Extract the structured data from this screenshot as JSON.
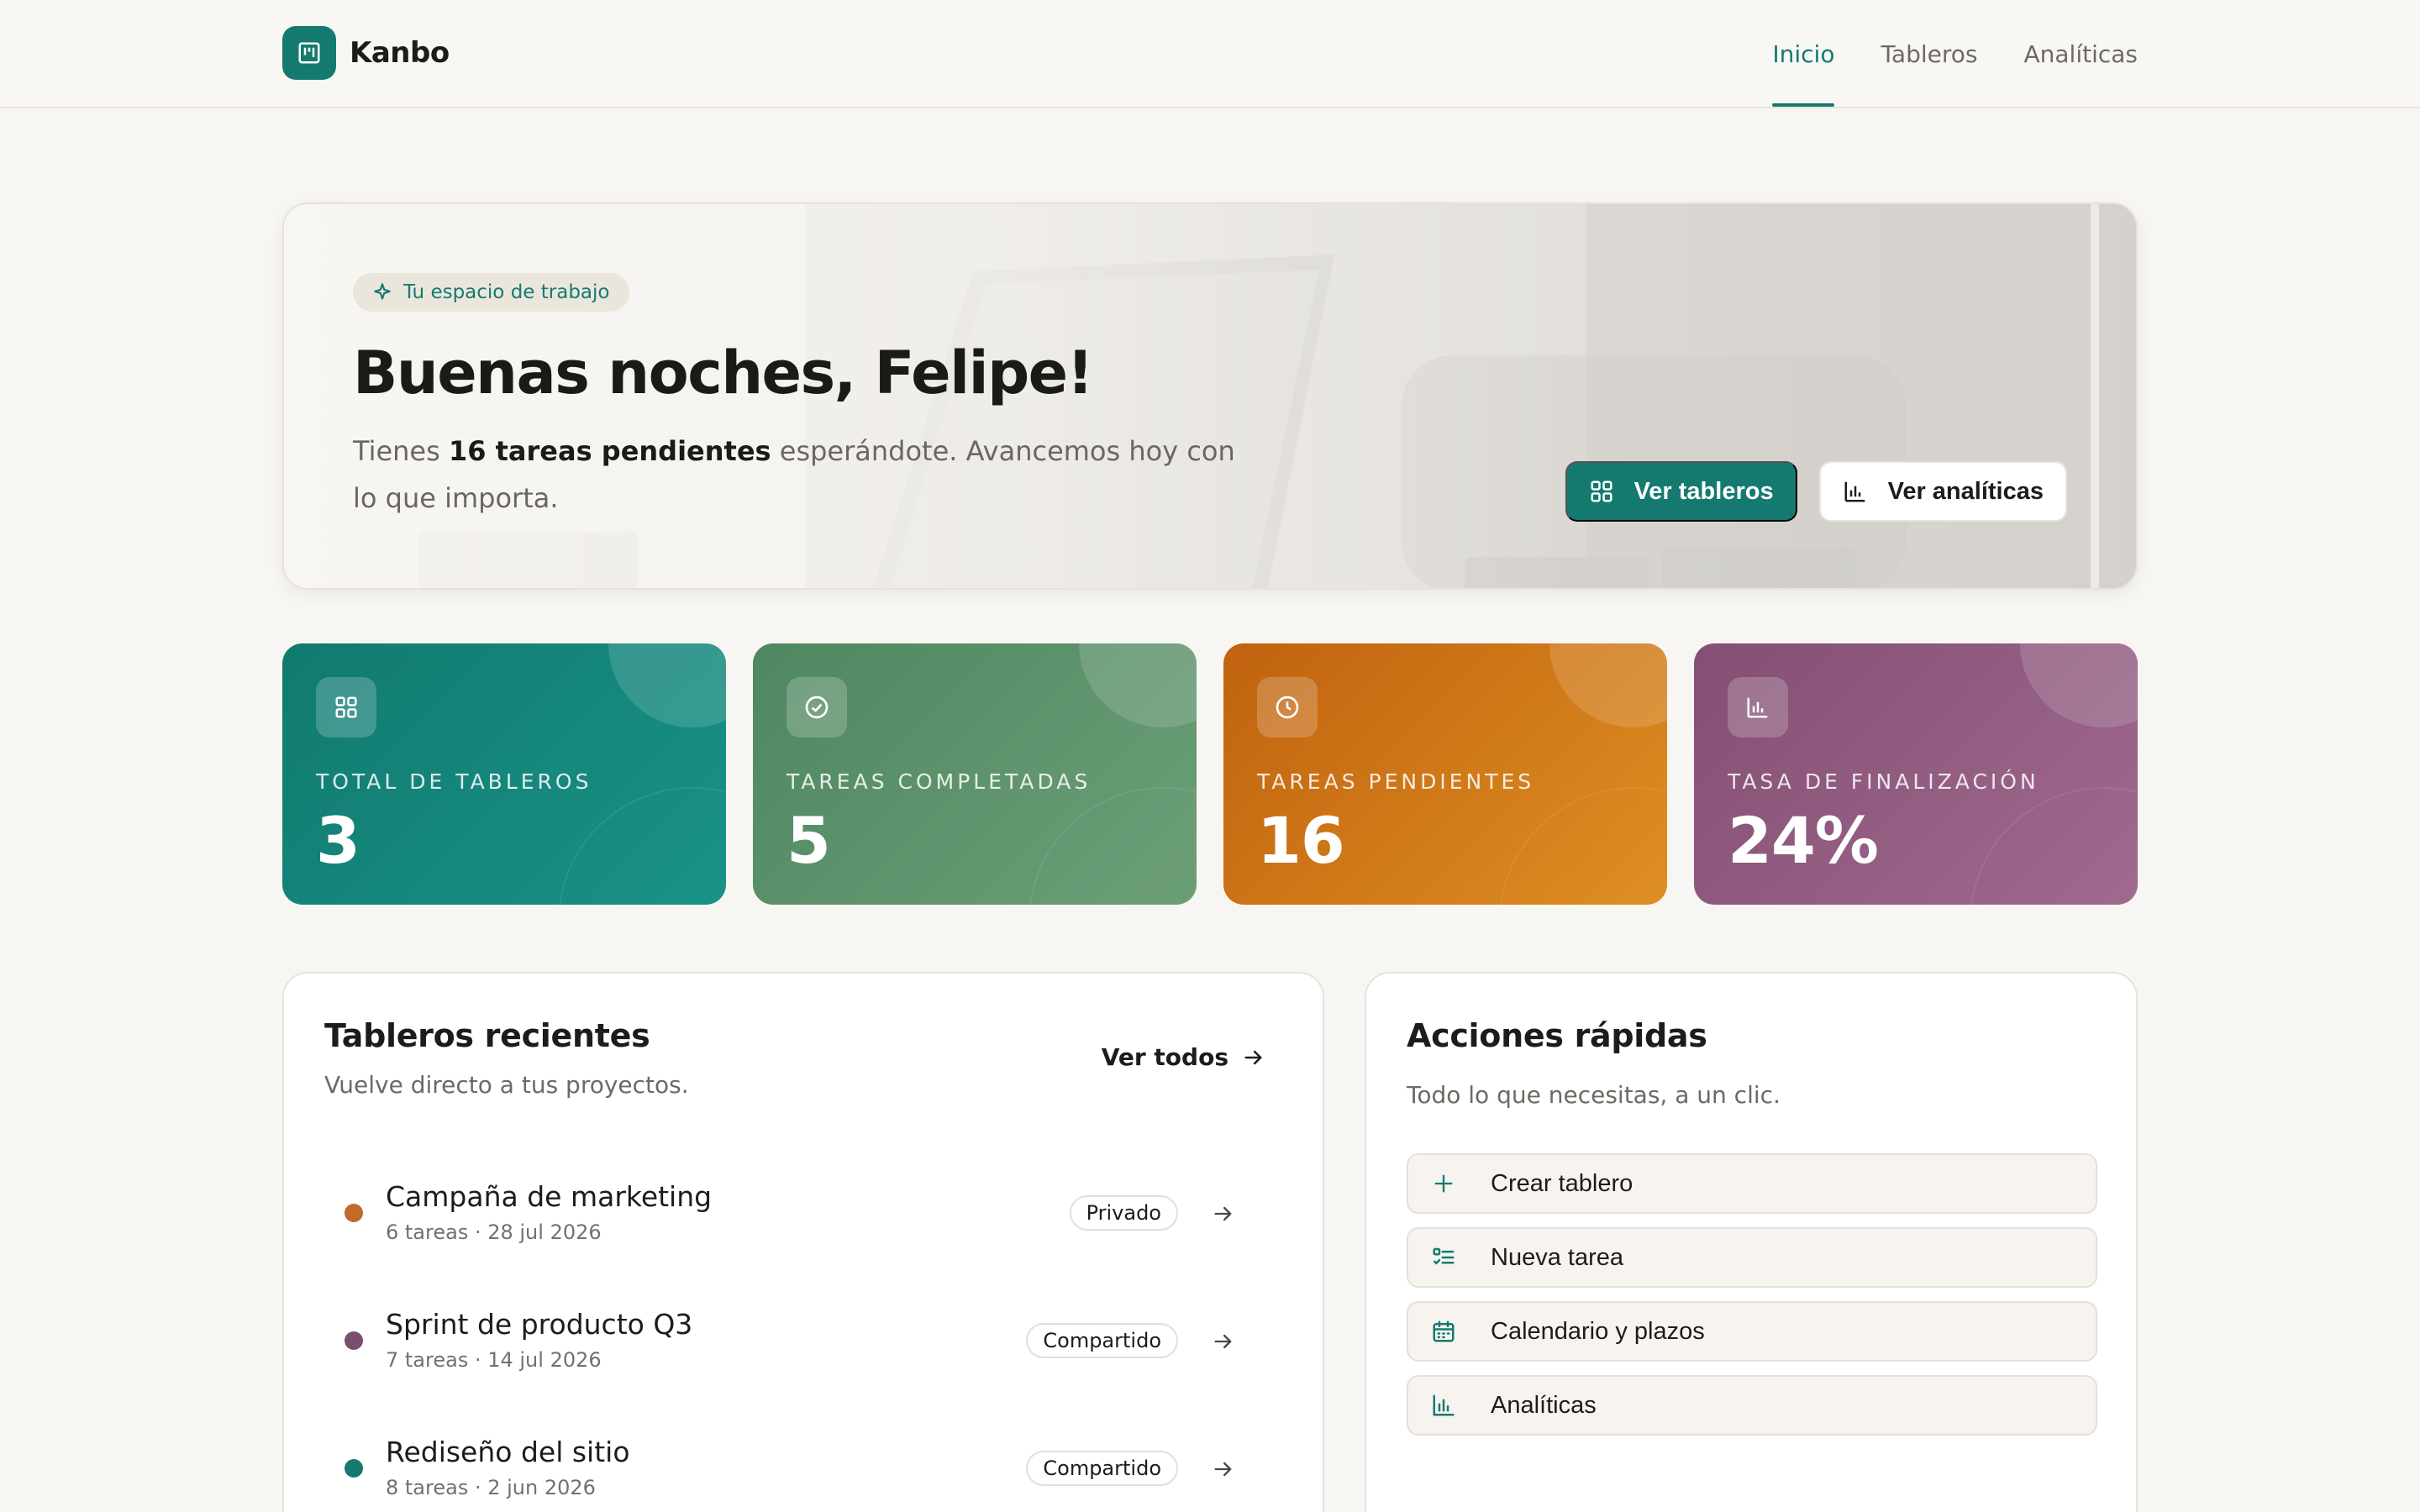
{
  "app": {
    "name": "Kanbo"
  },
  "nav": {
    "items": [
      {
        "label": "Inicio",
        "active": true
      },
      {
        "label": "Tableros",
        "active": false
      },
      {
        "label": "Analíticas",
        "active": false
      }
    ]
  },
  "hero": {
    "badge": "Tu espacio de trabajo",
    "title": "Buenas noches, Felipe!",
    "sub_prefix": "Tienes ",
    "sub_bold": "16 tareas pendientes",
    "sub_suffix": " esperándote. Avancemos hoy con lo que importa.",
    "primary_button": "Ver tableros",
    "secondary_button": "Ver analíticas"
  },
  "stats": [
    {
      "label": "TOTAL DE TABLEROS",
      "value": "3",
      "icon": "grid-icon"
    },
    {
      "label": "TAREAS COMPLETADAS",
      "value": "5",
      "icon": "check-circle-icon"
    },
    {
      "label": "TAREAS PENDIENTES",
      "value": "16",
      "icon": "clock-icon"
    },
    {
      "label": "TASA DE FINALIZACIÓN",
      "value": "24%",
      "icon": "bar-chart-icon"
    }
  ],
  "recent": {
    "title": "Tableros recientes",
    "subtitle": "Vuelve directo a tus proyectos.",
    "see_all": "Ver todos",
    "boards": [
      {
        "name": "Campaña de marketing",
        "meta": "6 tareas · 28 jul 2026",
        "tag": "Privado",
        "color": "#c06a2b"
      },
      {
        "name": "Sprint de producto Q3",
        "meta": "7 tareas · 14 jul 2026",
        "tag": "Compartido",
        "color": "#7a4f6e"
      },
      {
        "name": "Rediseño del sitio",
        "meta": "8 tareas · 2 jun 2026",
        "tag": "Compartido",
        "color": "#147a70"
      }
    ]
  },
  "quick": {
    "title": "Acciones rápidas",
    "subtitle": "Todo lo que necesitas, a un clic.",
    "actions": [
      {
        "label": "Crear tablero",
        "icon": "plus-icon"
      },
      {
        "label": "Nueva tarea",
        "icon": "checklist-icon"
      },
      {
        "label": "Calendario y plazos",
        "icon": "calendar-icon"
      },
      {
        "label": "Analíticas",
        "icon": "bar-chart-icon"
      }
    ]
  },
  "colors": {
    "accent": "#147a70",
    "background": "#f8f6f2"
  }
}
